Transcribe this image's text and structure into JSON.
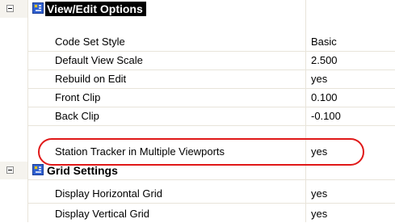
{
  "categories": [
    {
      "title": "View/Edit Options",
      "expander": "−",
      "icon": "categorized-icon",
      "properties": [
        {
          "name": "Code Set Style",
          "value": "Basic"
        },
        {
          "name": "Default View Scale",
          "value": "2.500"
        },
        {
          "name": "Rebuild on Edit",
          "value": "yes"
        },
        {
          "name": "Front Clip",
          "value": "0.100"
        },
        {
          "name": "Back Clip",
          "value": "-0.100"
        },
        {
          "name": "Station Tracker in Multiple Viewports",
          "value": "yes"
        }
      ]
    },
    {
      "title": "Grid Settings",
      "expander": "−",
      "icon": "categorized-icon",
      "properties": [
        {
          "name": "Display Horizontal Grid",
          "value": "yes"
        },
        {
          "name": "Display Vertical Grid",
          "value": "yes"
        }
      ]
    }
  ],
  "colors": {
    "gutter": "#f5f3ee",
    "grid_line": "#e8e4da",
    "highlight_ellipse": "#e01818",
    "category_icon": "#3060d0"
  }
}
